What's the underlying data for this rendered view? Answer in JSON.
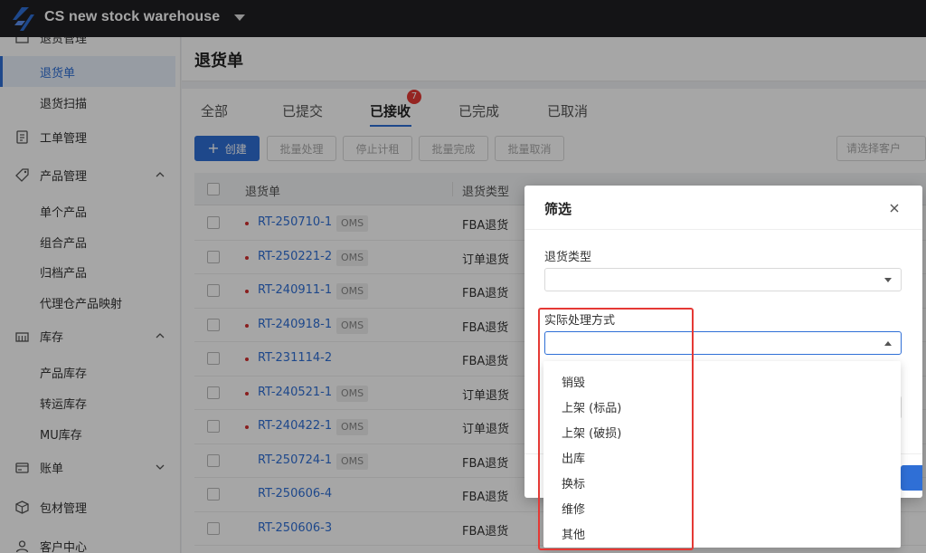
{
  "app": {
    "title": "CS new stock warehouse"
  },
  "sidebar": {
    "items": [
      {
        "label": "退货管理"
      },
      {
        "label": "退货单"
      },
      {
        "label": "退货扫描"
      },
      {
        "label": "工单管理"
      },
      {
        "label": "产品管理"
      },
      {
        "label": "单个产品"
      },
      {
        "label": "组合产品"
      },
      {
        "label": "归档产品"
      },
      {
        "label": "代理仓产品映射"
      },
      {
        "label": "库存"
      },
      {
        "label": "产品库存"
      },
      {
        "label": "转运库存"
      },
      {
        "label": "MU库存"
      },
      {
        "label": "账单"
      },
      {
        "label": "包材管理"
      },
      {
        "label": "客户中心"
      }
    ]
  },
  "page": {
    "title": "退货单"
  },
  "tabs": [
    {
      "label": "全部"
    },
    {
      "label": "已提交"
    },
    {
      "label": "已接收",
      "badge": "7"
    },
    {
      "label": "已完成"
    },
    {
      "label": "已取消"
    }
  ],
  "toolbar": {
    "create": "创建",
    "batch_process": "批量处理",
    "stop_rent": "停止计租",
    "batch_complete": "批量完成",
    "batch_cancel": "批量取消",
    "customer_placeholder": "请选择客户"
  },
  "table": {
    "columns": [
      "退货单",
      "退货类型"
    ],
    "rows": [
      {
        "id": "RT-250710-1",
        "tag": "OMS",
        "type": "FBA退货",
        "dot": true
      },
      {
        "id": "RT-250221-2",
        "tag": "OMS",
        "type": "订单退货",
        "dot": true
      },
      {
        "id": "RT-240911-1",
        "tag": "OMS",
        "type": "FBA退货",
        "dot": true
      },
      {
        "id": "RT-240918-1",
        "tag": "OMS",
        "type": "FBA退货",
        "dot": true
      },
      {
        "id": "RT-231114-2",
        "tag": "",
        "type": "FBA退货",
        "dot": true
      },
      {
        "id": "RT-240521-1",
        "tag": "OMS",
        "type": "订单退货",
        "dot": true
      },
      {
        "id": "RT-240422-1",
        "tag": "OMS",
        "type": "订单退货",
        "dot": true
      },
      {
        "id": "RT-250724-1",
        "tag": "OMS",
        "type": "FBA退货",
        "dot": false
      },
      {
        "id": "RT-250606-4",
        "tag": "",
        "type": "FBA退货",
        "dot": false
      },
      {
        "id": "RT-250606-3",
        "tag": "",
        "type": "FBA退货",
        "dot": false
      }
    ]
  },
  "modal": {
    "title": "筛选",
    "return_type_label": "退货类型",
    "actual_method_label": "实际处理方式",
    "options": [
      "销毁",
      "上架 (标品)",
      "上架 (破损)",
      "出库",
      "换标",
      "维修",
      "其他"
    ]
  },
  "colors": {
    "accent": "#2f6fd6",
    "highlight": "#e53935",
    "topbar": "#1f1f23"
  }
}
